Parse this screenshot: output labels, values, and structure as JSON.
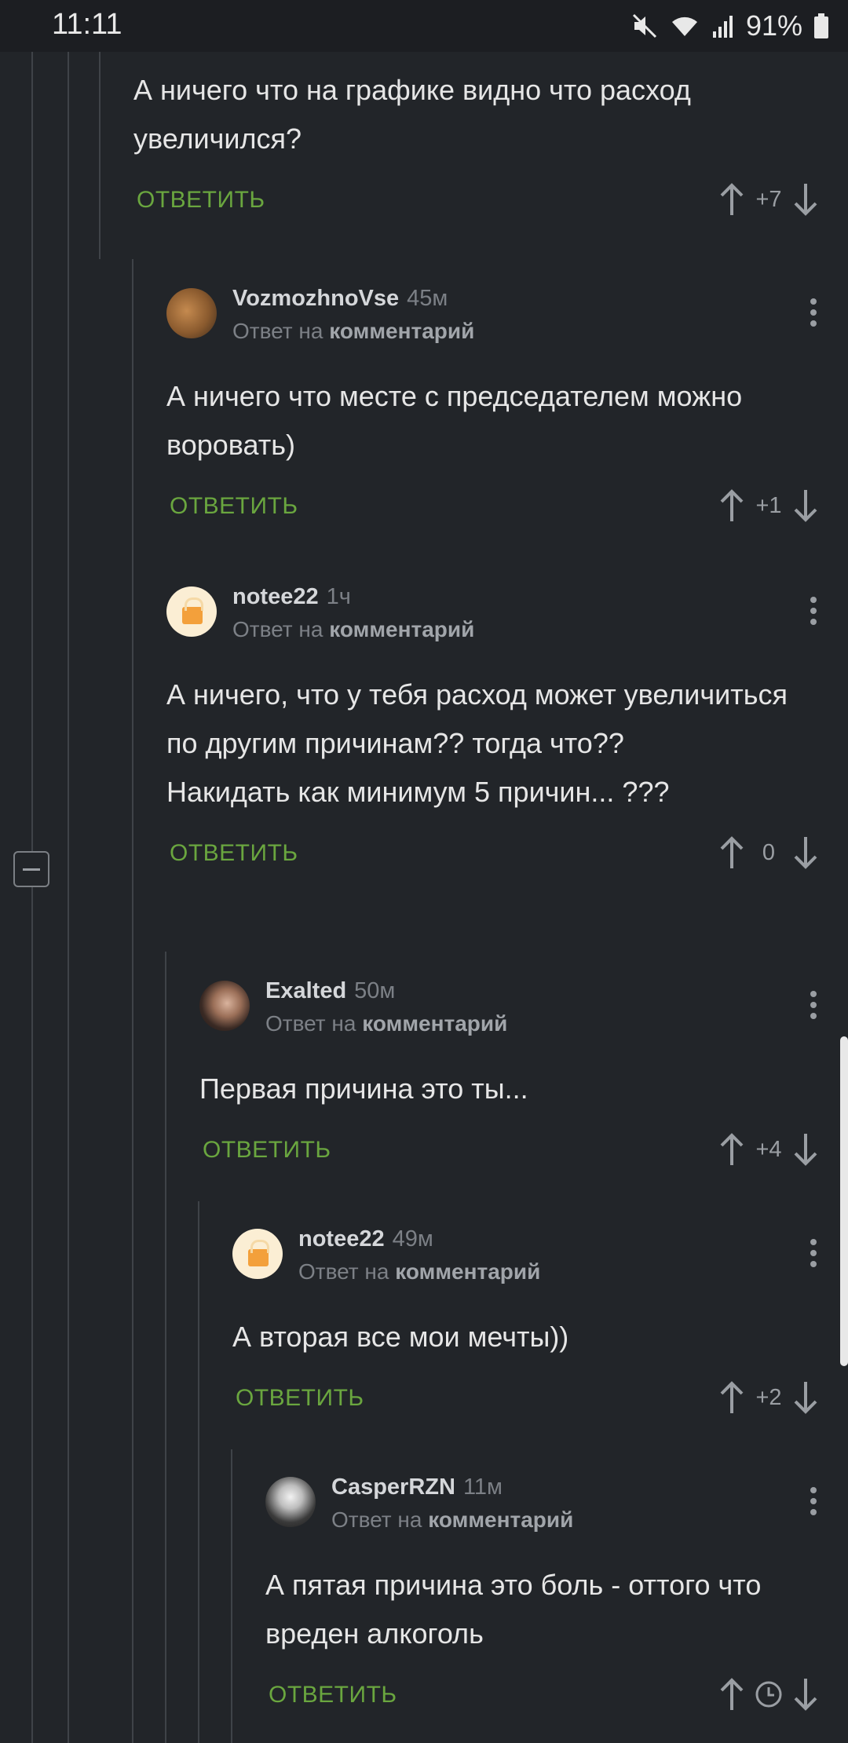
{
  "status_bar": {
    "time": "11:11",
    "battery": "91%"
  },
  "top_comment": {
    "text": "А ничего что на графике видно что расход увеличился?",
    "reply_label": "ОТВЕТИТЬ",
    "score": "+7"
  },
  "comments": [
    {
      "author": "VozmozhnoVse",
      "time": "45м",
      "reply_prefix": "Ответ на",
      "reply_target": "комментарий",
      "text": "А ничего что месте с председателем можно воровать)",
      "reply_label": "ОТВЕТИТЬ",
      "score": "+1"
    },
    {
      "author": "notee22",
      "time": "1ч",
      "reply_prefix": "Ответ на",
      "reply_target": "комментарий",
      "text_lines": [
        "А ничего, что у тебя расход может увеличиться по другим причинам?? тогда что??",
        "Накидать как минимум 5 причин...  ???"
      ],
      "reply_label": "ОТВЕТИТЬ",
      "score": "0"
    },
    {
      "author": "Exalted",
      "time": "50м",
      "reply_prefix": "Ответ на",
      "reply_target": "комментарий",
      "text": "Первая причина это ты...",
      "reply_label": "ОТВЕТИТЬ",
      "score": "+4"
    },
    {
      "author": "notee22",
      "time": "49м",
      "reply_prefix": "Ответ на",
      "reply_target": "комментарий",
      "text": "А вторая все мои мечты))",
      "reply_label": "ОТВЕТИТЬ",
      "score": "+2"
    },
    {
      "author": "CasperRZN",
      "time": "11м",
      "reply_prefix": "Ответ на",
      "reply_target": "комментарий",
      "text": "А пятая причина это боль - оттого что вреден алкоголь",
      "reply_label": "ОТВЕТИТЬ",
      "score_icon": "clock-icon"
    }
  ]
}
